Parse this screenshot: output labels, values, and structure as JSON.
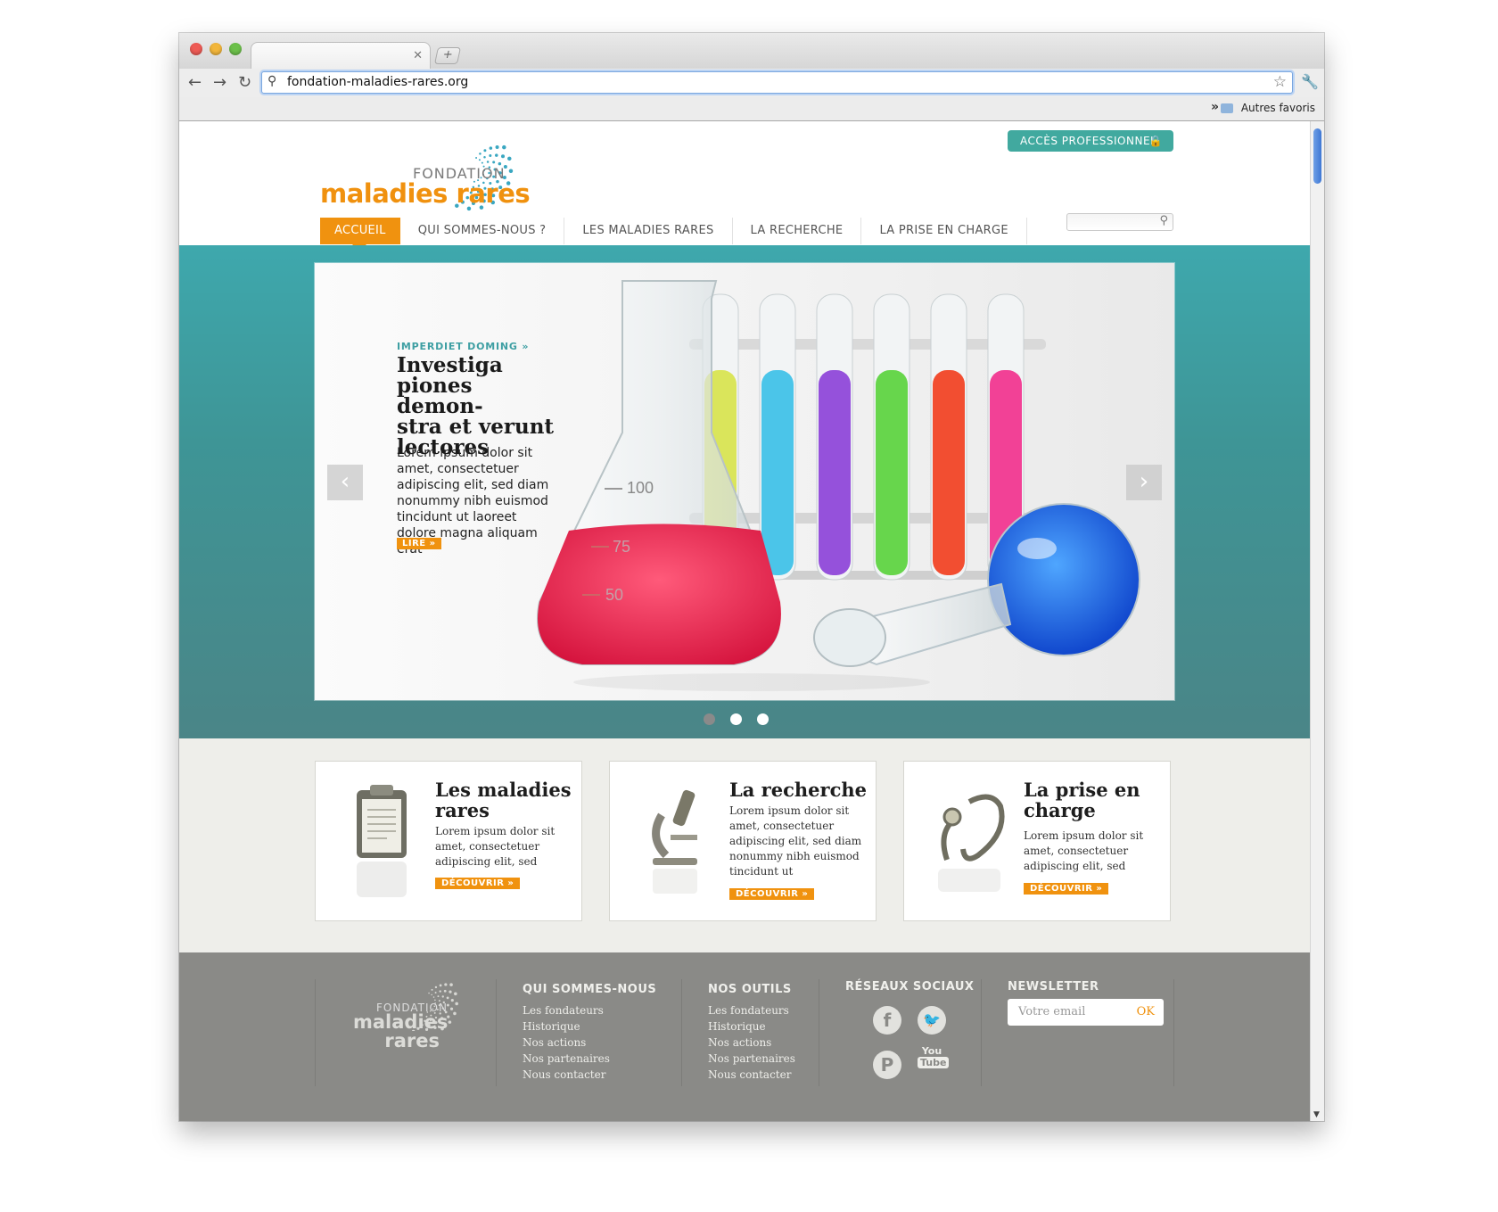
{
  "browser": {
    "url": "fondation-maladies-rares.org",
    "bookmarks_folder": "Autres favoris",
    "new_tab_label": "+",
    "chevron": "»"
  },
  "site": {
    "logo_top": "FONDATION",
    "logo_main": "maladies rares",
    "pro_button": "ACCÈS PROFESSIONNEL",
    "menu": [
      "ACCUEIL",
      "QUI SOMMES-NOUS ?",
      "LES MALADIES RARES",
      "LA RECHERCHE",
      "LA PRISE EN CHARGE"
    ]
  },
  "hero": {
    "kicker": "IMPERDIET DOMING »",
    "title_lines": [
      "Investiga",
      "piones demon-",
      "stra et verunt",
      "lectores"
    ],
    "text": "Lorem ipsum dolor sit amet, consectetuer adipiscing elit, sed diam nonummy nibh euismod tincidunt ut laoreet dolore magna aliquam erat",
    "button": "LIRE »",
    "beaker_marks": [
      "100",
      "75",
      "50"
    ],
    "slide_count": 3,
    "active_slide": 1
  },
  "cards": [
    {
      "title": "Les maladies rares",
      "text": "Lorem ipsum dolor sit amet, consectetuer adipiscing elit, sed",
      "button": "DÉCOUVRIR »",
      "icon": "clipboard-icon"
    },
    {
      "title": "La recherche",
      "text": "Lorem ipsum dolor sit amet, consectetuer adipiscing elit, sed diam nonummy nibh euismod tincidunt ut",
      "button": "DÉCOUVRIR »",
      "icon": "microscope-icon"
    },
    {
      "title": "La prise en charge",
      "text": "Lorem ipsum dolor sit amet, consectetuer adipiscing elit, sed",
      "button": "DÉCOUVRIR »",
      "icon": "stethoscope-icon"
    }
  ],
  "footer": {
    "logo_top": "FONDATION",
    "logo_line1": "maladies",
    "logo_line2": "rares",
    "col1_title": "QUI SOMMES-NOUS",
    "col1_links": [
      "Les fondateurs",
      "Historique",
      "Nos actions",
      "Nos partenaires",
      "Nous contacter"
    ],
    "col2_title": "NOS OUTILS",
    "col2_links": [
      "Les fondateurs",
      "Historique",
      "Nos actions",
      "Nos partenaires",
      "Nous contacter"
    ],
    "social_title": "RÉSEAUX SOCIAUX",
    "social_icons": [
      "facebook-icon",
      "twitter-icon",
      "pinterest-icon",
      "youtube-icon"
    ],
    "newsletter_title": "NEWSLETTER",
    "newsletter_placeholder": "Votre email",
    "newsletter_ok": "OK"
  },
  "colors": {
    "brand_orange": "#f0920f",
    "brand_teal": "#3e9fa3",
    "footer_grey": "#8a8a87"
  }
}
